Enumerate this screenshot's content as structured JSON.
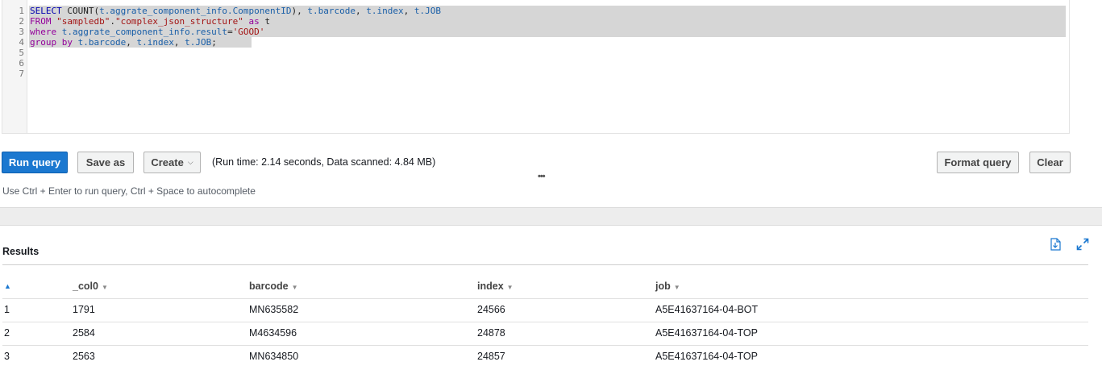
{
  "editor": {
    "line_numbers": [
      "1",
      "2",
      "3",
      "4",
      "5",
      "6",
      "7"
    ],
    "lines": [
      [
        {
          "t": "SELECT ",
          "c": "kw-blue"
        },
        {
          "t": "COUNT",
          "c": "plain"
        },
        {
          "t": "(",
          "c": "plain"
        },
        {
          "t": "t.aggrate_component_info.ComponentID",
          "c": "id"
        },
        {
          "t": "), ",
          "c": "plain"
        },
        {
          "t": "t.barcode",
          "c": "id"
        },
        {
          "t": ", ",
          "c": "plain"
        },
        {
          "t": "t.index",
          "c": "id"
        },
        {
          "t": ", ",
          "c": "plain"
        },
        {
          "t": "t.JOB",
          "c": "id"
        }
      ],
      [
        {
          "t": "FROM ",
          "c": "kw"
        },
        {
          "t": "\"sampledb\"",
          "c": "str"
        },
        {
          "t": ".",
          "c": "plain"
        },
        {
          "t": "\"complex_json_structure\"",
          "c": "str"
        },
        {
          "t": " as ",
          "c": "kw"
        },
        {
          "t": "t",
          "c": "plain"
        }
      ],
      [
        {
          "t": "where ",
          "c": "kw"
        },
        {
          "t": "t.aggrate_component_info.result",
          "c": "id"
        },
        {
          "t": "=",
          "c": "plain"
        },
        {
          "t": "'GOOD'",
          "c": "str"
        }
      ],
      [
        {
          "t": "group by ",
          "c": "kw"
        },
        {
          "t": "t.barcode",
          "c": "id"
        },
        {
          "t": ", ",
          "c": "plain"
        },
        {
          "t": "t.index",
          "c": "id"
        },
        {
          "t": ", ",
          "c": "plain"
        },
        {
          "t": "t.JOB",
          "c": "id"
        },
        {
          "t": ";",
          "c": "plain"
        }
      ],
      [],
      [],
      []
    ]
  },
  "toolbar": {
    "run_label": "Run query",
    "save_label": "Save as",
    "create_label": "Create",
    "create_caret": "⌵",
    "run_info": "(Run time: 2.14 seconds, Data scanned: 4.84 MB)",
    "resize_handle": "•••",
    "format_label": "Format query",
    "clear_label": "Clear"
  },
  "hint": "Use Ctrl + Enter to run query, Ctrl + Space to autocomplete",
  "results": {
    "title": "Results",
    "sort_indicator": "▲",
    "columns": [
      "_col0",
      "barcode",
      "index",
      "job"
    ],
    "column_caret": "▼",
    "rows": [
      {
        "num": "1",
        "cells": [
          "1791",
          "MN635582",
          "24566",
          "A5E41637164-04-BOT"
        ]
      },
      {
        "num": "2",
        "cells": [
          "2584",
          "M4634596",
          "24878",
          "A5E41637164-04-TOP"
        ]
      },
      {
        "num": "3",
        "cells": [
          "2563",
          "MN634850",
          "24857",
          "A5E41637164-04-TOP"
        ]
      }
    ],
    "download_icon": "download-csv-icon",
    "expand_icon": "expand-icon"
  },
  "colors": {
    "primary": "#1b78d0",
    "keyword": "#93009b",
    "string": "#a31515",
    "identifier": "#1a5fa8"
  }
}
